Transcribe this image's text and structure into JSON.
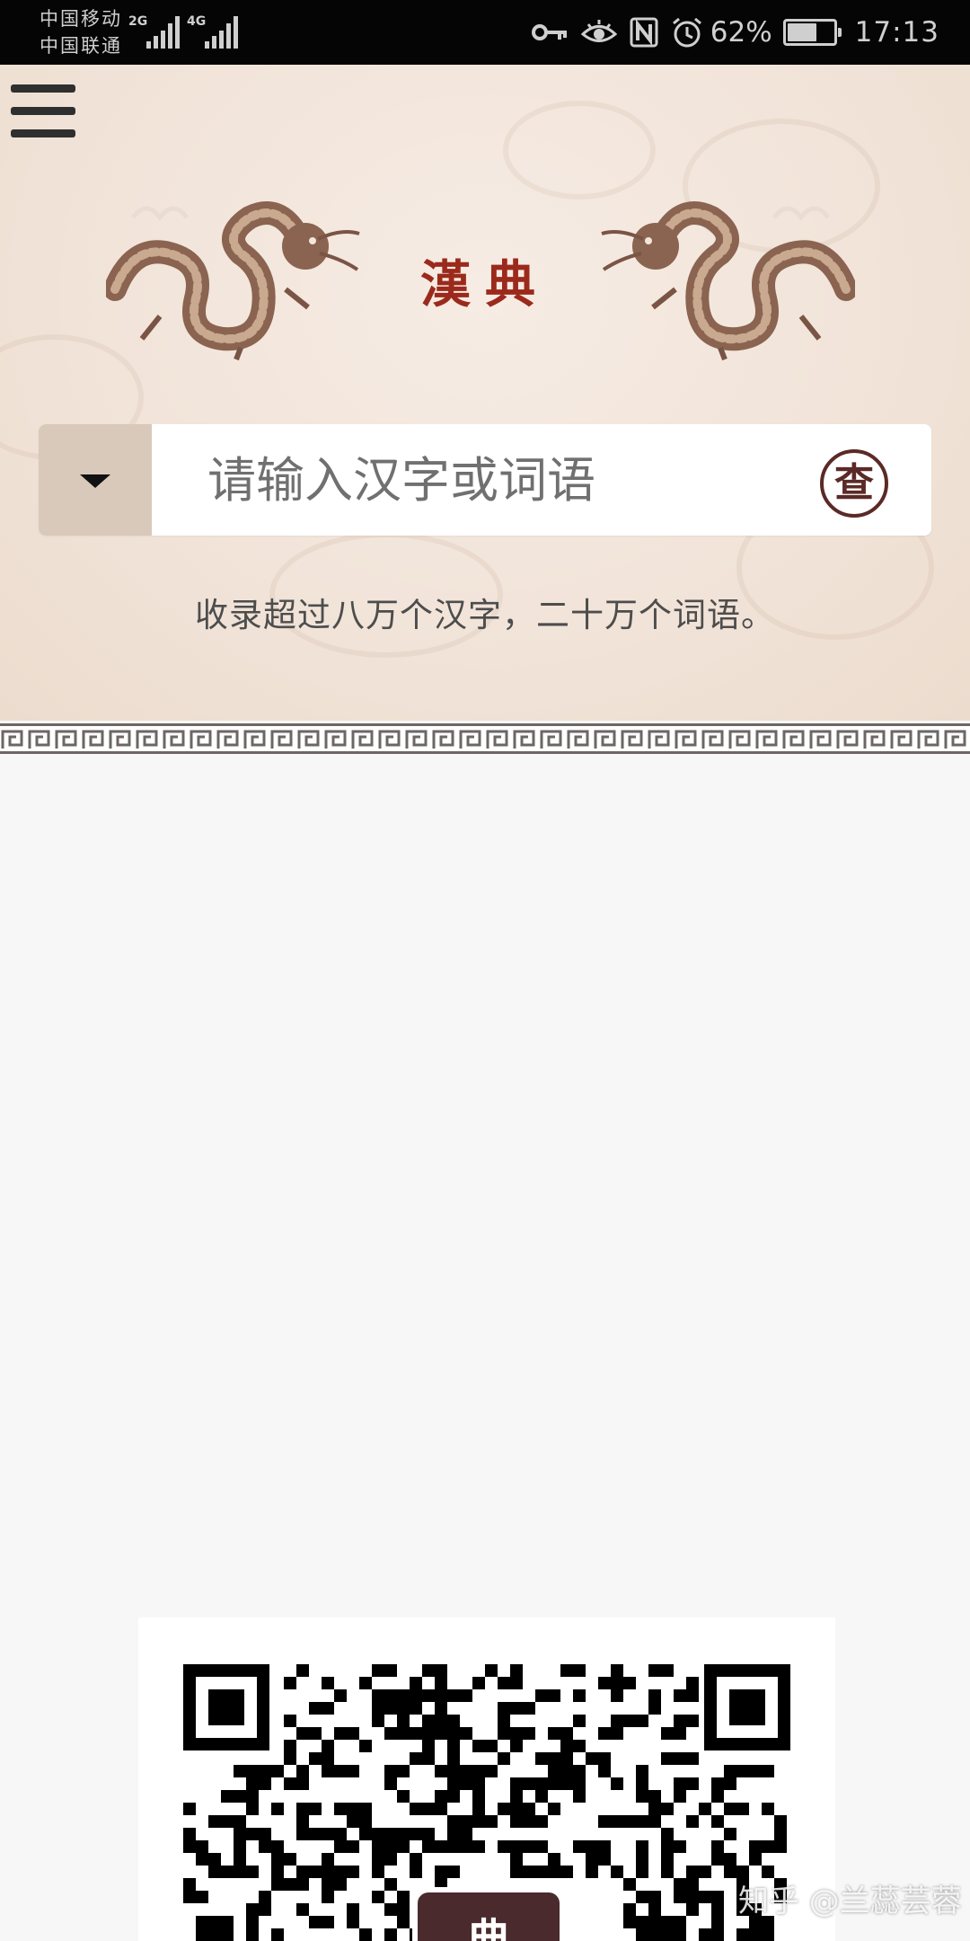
{
  "status_bar": {
    "carrier_1": "中国移动",
    "carrier_2": "中国联通",
    "network_1": "2G",
    "network_2": "4G",
    "battery_percent": "62%",
    "battery_level": 0.62,
    "time": "17:13",
    "icons": [
      "key-icon",
      "eye-icon",
      "nfc-icon",
      "alarm-icon",
      "battery-icon"
    ]
  },
  "header": {
    "menu_icon": "hamburger-menu-icon",
    "logo": "漢典"
  },
  "search": {
    "placeholder": "请输入汉字或词语",
    "button_label": "查",
    "dropdown_icon": "caret-down-icon"
  },
  "tagline": "收录超过八万个汉字，二十万个词语。",
  "qr": {
    "logo_text": "典"
  },
  "watermark": "知乎 @兰蕊芸蓉",
  "colors": {
    "header_bg": "#f1e3d8",
    "accent_red": "#9b2a1c",
    "button_brown": "#5b2a26",
    "dropdown_bg": "#d8c9bb"
  }
}
